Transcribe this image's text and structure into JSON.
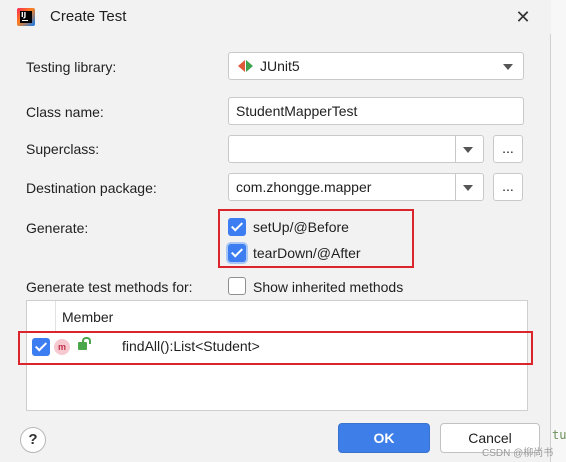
{
  "window": {
    "title": "Create Test",
    "close_glyph": "✕",
    "app_icon_text": "IJ"
  },
  "form": {
    "testing_library": {
      "label": "Testing library:",
      "value": "JUnit5",
      "icon": "junit5-icon"
    },
    "class_name": {
      "label": "Class name:",
      "value": "StudentMapperTest"
    },
    "superclass": {
      "label": "Superclass:",
      "value": "",
      "browse_label": "..."
    },
    "destination_package": {
      "label": "Destination package:",
      "value": "com.zhongge.mapper",
      "browse_label": "..."
    },
    "generate": {
      "label": "Generate:",
      "options": [
        {
          "label": "setUp/@Before",
          "checked": true
        },
        {
          "label": "tearDown/@After",
          "checked": true
        }
      ]
    },
    "generate_methods": {
      "label": "Generate test methods for:",
      "show_inherited": {
        "label": "Show inherited methods",
        "checked": false
      }
    }
  },
  "members_table": {
    "header": "Member",
    "rows": [
      {
        "checked": true,
        "kind_icon": "method-icon",
        "kind_glyph": "m",
        "access_icon": "public-lock-icon",
        "signature": "findAll():List<Student>"
      }
    ]
  },
  "buttons": {
    "help": "?",
    "ok": "OK",
    "cancel": "Cancel"
  },
  "colors": {
    "primary_button": "#3d7ee8",
    "checkbox_checked": "#3c7ef2",
    "highlight_box": "#d9252b"
  },
  "background_text": "tu",
  "watermark": "CSDN @柳尚书"
}
